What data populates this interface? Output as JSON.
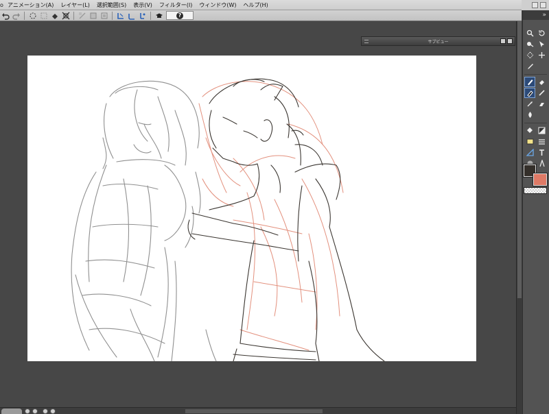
{
  "menu": {
    "edge": "ο",
    "items": [
      "アニメーション(A)",
      "レイヤー(L)",
      "選択範囲(S)",
      "表示(V)",
      "フィルター(I)",
      "ウィンドウ(W)",
      "ヘルプ(H)"
    ]
  },
  "command_bar": {
    "icons": [
      "undo-icon",
      "redo-icon",
      "transform-icon",
      "clear-selection-icon",
      "fill-icon",
      "move-icon",
      "snap-icon",
      "ruler-snap-icon",
      "magnet-icon",
      "special-ruler-icon",
      "cap-icon",
      "help-icon"
    ],
    "help_label": "?"
  },
  "subview": {
    "title": "サブビュー"
  },
  "tools": {
    "header_label": "»",
    "icons": [
      "zoom-icon",
      "rotate-icon",
      "hand-icon",
      "operation-icon",
      "lasso-icon",
      "move-layer-icon",
      "eyedropper-icon",
      "",
      "pen-icon",
      "eraser-icon",
      "pencil-icon",
      "marker-icon",
      "brush-icon",
      "airbrush-icon",
      "decoration-icon",
      "blend-icon",
      "fill-icon",
      "gradient-icon",
      "figure-icon",
      "frame-icon",
      "ruler-icon",
      "text-icon",
      "balloon-icon",
      "correct-line-icon"
    ],
    "active": [
      "pen-icon",
      "pencil-icon"
    ],
    "main_color": "#342f2a",
    "sub_color": "#df7a66"
  },
  "canvas": {
    "paper_color": "#ffffff",
    "line_color_gray": "#8a8a8a",
    "line_color_dark": "#3a3530",
    "line_color_red": "#e3907d"
  }
}
